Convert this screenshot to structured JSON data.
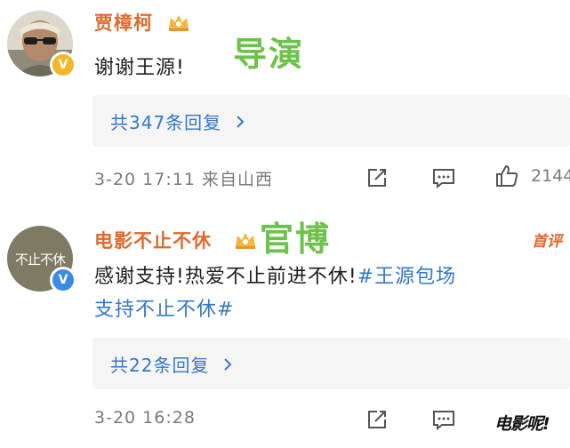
{
  "comments": [
    {
      "username": "贾樟柯",
      "overlay_label": "导演",
      "text": "谢谢王源!",
      "reply_link": "共347条回复",
      "meta": "3-20 17:11 来自山西",
      "likes": "2144",
      "avatar_icon": "person-sunglasses-avatar",
      "badge_icon": "crown-vip-icon",
      "verified_color": "#f6b429"
    },
    {
      "username": "电影不止不休",
      "overlay_label": "官博",
      "first_badge": "首评",
      "avatar_text": "不止不休",
      "text_line1": "感谢支持!热爱不止前进不休!",
      "topic_part1": "#王源包场",
      "topic_part2": "支持不止不休#",
      "reply_link": "共22条回复",
      "meta": "3-20 16:28",
      "badge_icon": "crown-vip-icon",
      "verified_color": "#3b8ae8"
    }
  ],
  "watermark": "电影呢!",
  "colors": {
    "username": "#e06a2a",
    "link": "#3577c9",
    "overlay": "#6cc24a",
    "meta": "#7a7a7a",
    "reply_bg": "#f5f5f5"
  }
}
